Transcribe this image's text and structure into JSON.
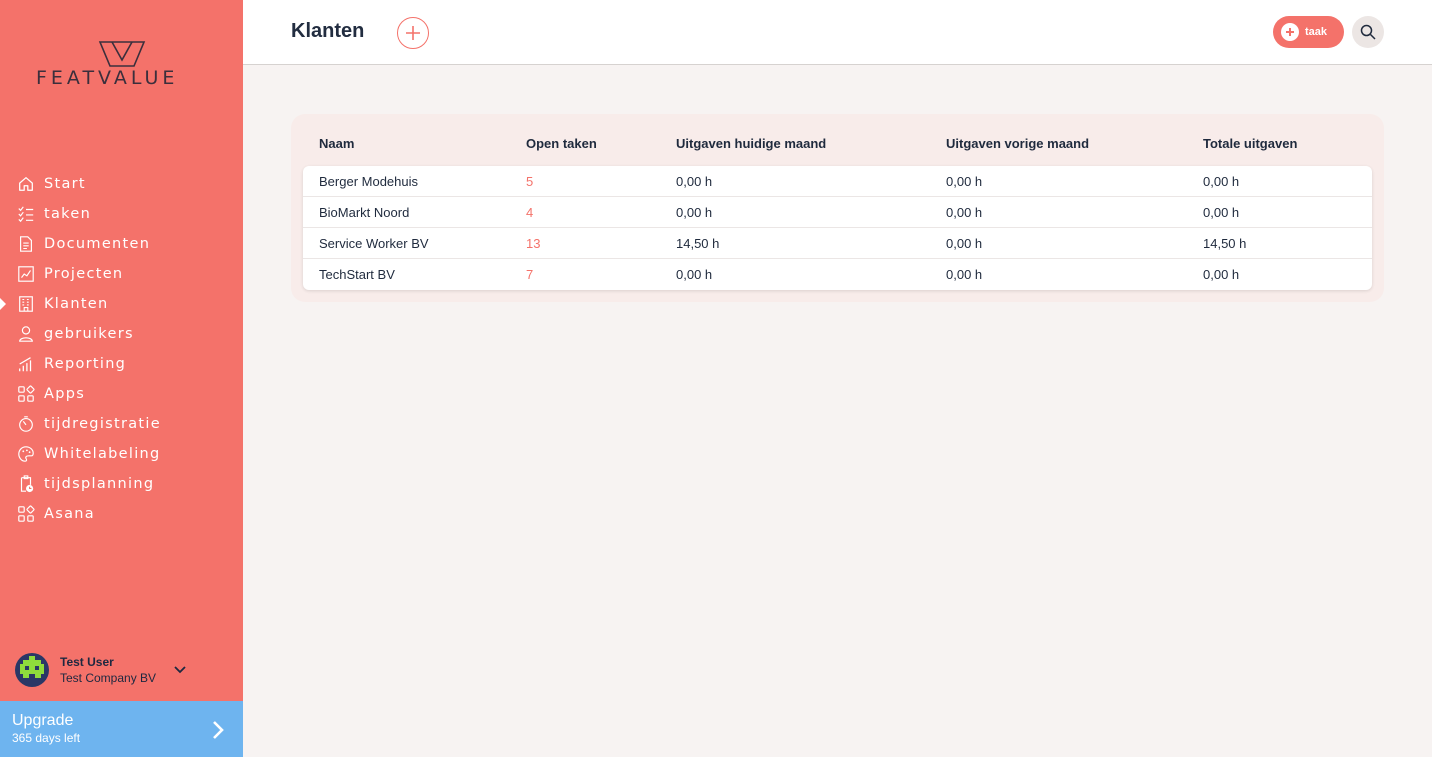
{
  "logo": {
    "text": "FEATVALUE"
  },
  "nav": [
    {
      "label": "Start",
      "icon": "home-icon",
      "active": false
    },
    {
      "label": "taken",
      "icon": "checklist-icon",
      "active": false
    },
    {
      "label": "Documenten",
      "icon": "document-icon",
      "active": false
    },
    {
      "label": "Projecten",
      "icon": "chart-icon",
      "active": false
    },
    {
      "label": "Klanten",
      "icon": "building-icon",
      "active": true
    },
    {
      "label": "gebruikers",
      "icon": "user-icon",
      "active": false
    },
    {
      "label": "Reporting",
      "icon": "bar-chart-icon",
      "active": false
    },
    {
      "label": "Apps",
      "icon": "apps-icon",
      "active": false
    },
    {
      "label": "tijdregistratie",
      "icon": "timer-icon",
      "active": false
    },
    {
      "label": "Whitelabeling",
      "icon": "palette-icon",
      "active": false
    },
    {
      "label": "tijdsplanning",
      "icon": "clipboard-clock-icon",
      "active": false
    },
    {
      "label": "Asana",
      "icon": "apps-icon",
      "active": false
    }
  ],
  "user": {
    "name": "Test User",
    "company": "Test Company BV"
  },
  "upgrade": {
    "title": "Upgrade",
    "subtitle": "365 days left"
  },
  "header": {
    "title": "Klanten",
    "task_label": "taak"
  },
  "table": {
    "columns": [
      "Naam",
      "Open taken",
      "Uitgaven huidige maand",
      "Uitgaven vorige maand",
      "Totale uitgaven"
    ],
    "rows": [
      {
        "name": "Berger Modehuis",
        "open": "5",
        "current": "0,00 h",
        "previous": "0,00 h",
        "total": "0,00 h"
      },
      {
        "name": "BioMarkt Noord",
        "open": "4",
        "current": "0,00 h",
        "previous": "0,00 h",
        "total": "0,00 h"
      },
      {
        "name": "Service Worker BV",
        "open": "13",
        "current": "14,50 h",
        "previous": "0,00 h",
        "total": "14,50 h"
      },
      {
        "name": "TechStart BV",
        "open": "7",
        "current": "0,00 h",
        "previous": "0,00 h",
        "total": "0,00 h"
      }
    ]
  },
  "colors": {
    "sidebar": "#f4726a",
    "accent": "#f4726a",
    "upgrade": "#6eb4ef",
    "background": "#f7f3f2"
  }
}
